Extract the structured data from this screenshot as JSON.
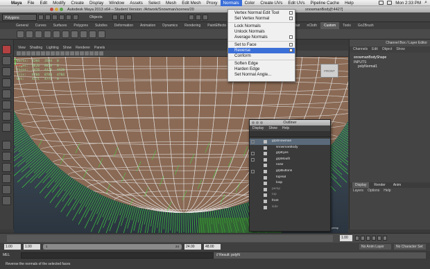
{
  "mac_menubar": {
    "app": "Maya",
    "items": [
      "File",
      "Edit",
      "Modify",
      "Create",
      "Display",
      "Window",
      "Assets",
      "Select",
      "Mesh",
      "Edit Mesh",
      "Proxy",
      "Normals",
      "Color",
      "Create UVs",
      "Edit UVs",
      "Pipeline Cache",
      "Help"
    ],
    "active_index": 11,
    "clock": "Mon 2:33 PM"
  },
  "titlebar": {
    "title": "Autodesk Maya 2013 x64 – Student Version: /Artwork/Snowman/scenes/20",
    "title_right": "snowmanBody[f:4427]"
  },
  "statusline": {
    "mode": "Polygons",
    "objects_label": "Objects"
  },
  "shelf": {
    "tabs": [
      "General",
      "Curves",
      "Surfaces",
      "Polygons",
      "Subdivs",
      "Deformation",
      "Animation",
      "Dynamics",
      "Rendering",
      "PaintEffects",
      "Toon",
      "Muscle",
      "Fluids",
      "Fur",
      "Hair",
      "nCloth",
      "Custom",
      "Tools",
      "GoZBrush"
    ],
    "active_index": 16
  },
  "viewport": {
    "menu": [
      "View",
      "Shading",
      "Lighting",
      "Show",
      "Renderer",
      "Panels"
    ],
    "hud": [
      {
        "label": "Verts:",
        "a": "4204",
        "b": "3584",
        "c": "0"
      },
      {
        "label": "Edges:",
        "a": "8820",
        "b": "8820",
        "c": "0"
      },
      {
        "label": "Faces:",
        "a": "4428",
        "b": "4428",
        "c": "4428"
      },
      {
        "label": "Tris:",
        "a": "8784",
        "b": "8784",
        "c": "4784"
      },
      {
        "label": "UVs:",
        "a": "4771",
        "b": "4771",
        "c": "0"
      }
    ],
    "viewcube_label": "FRONT",
    "camera_label": "persp"
  },
  "normals_menu": {
    "items": [
      {
        "label": "Vertex Normal Edit Tool",
        "option": true
      },
      {
        "label": "Set Vertex Normal",
        "option": true
      },
      {
        "sep": true
      },
      {
        "label": "Lock Normals",
        "option": false
      },
      {
        "label": "Unlock Normals",
        "option": false
      },
      {
        "label": "Average Normals",
        "option": true
      },
      {
        "sep": true
      },
      {
        "label": "Set to Face",
        "option": true
      },
      {
        "label": "Reverse",
        "option": true,
        "highlight": true
      },
      {
        "label": "Conform",
        "option": false
      },
      {
        "sep": true
      },
      {
        "label": "Soften Edge",
        "option": false
      },
      {
        "label": "Harden Edge",
        "option": false
      },
      {
        "label": "Set Normal Angle...",
        "option": false
      }
    ]
  },
  "channel_box": {
    "title": "Channel Box / Layer Editor",
    "menu": [
      "Channels",
      "Edit",
      "Object",
      "Show"
    ],
    "node": "snowmanBodyShape",
    "inputs_label": "INPUTS",
    "input_node": "polyNormal1",
    "layer_tabs": [
      "Display",
      "Render",
      "Anim"
    ],
    "layer_active": 0,
    "layer_menu": [
      "Layers",
      "Options",
      "Help"
    ]
  },
  "outliner": {
    "title": "Outliner",
    "menu": [
      "Display",
      "Show",
      "Help"
    ],
    "rows": [
      {
        "label": "grpSnowman",
        "expand": true,
        "selected": true,
        "dim": false,
        "indent": 0
      },
      {
        "label": "snowmanBody",
        "expand": false,
        "selected": false,
        "dim": false,
        "indent": 1
      },
      {
        "label": "grpEyes",
        "expand": true,
        "selected": false,
        "dim": false,
        "indent": 1
      },
      {
        "label": "grpMouth",
        "expand": true,
        "selected": false,
        "dim": false,
        "indent": 1
      },
      {
        "label": "nose",
        "expand": false,
        "selected": false,
        "dim": false,
        "indent": 1
      },
      {
        "label": "grpButtons",
        "expand": true,
        "selected": false,
        "dim": false,
        "indent": 1
      },
      {
        "label": "topHat",
        "expand": false,
        "selected": false,
        "dim": false,
        "indent": 1
      },
      {
        "label": "loop",
        "expand": false,
        "selected": false,
        "dim": false,
        "indent": 1
      },
      {
        "label": "persp",
        "expand": false,
        "selected": false,
        "dim": true,
        "indent": 0
      },
      {
        "label": "top",
        "expand": false,
        "selected": false,
        "dim": true,
        "indent": 0
      },
      {
        "label": "front",
        "expand": false,
        "selected": false,
        "dim": false,
        "indent": 0
      },
      {
        "label": "side",
        "expand": false,
        "selected": false,
        "dim": true,
        "indent": 0
      }
    ]
  },
  "timeline": {
    "current_frame": "1.00"
  },
  "range": {
    "start": "1.00",
    "inner_start": "1.00",
    "slider_start": "1",
    "slider_end": "24",
    "inner_end": "24.00",
    "end": "48.00",
    "anim_layer": "No Anim Layer",
    "char_set": "No Character Set"
  },
  "cmdline": {
    "label": "MEL",
    "result": "// Result: polyN"
  },
  "helpline": {
    "text": "Reverse the normals of the selected faces"
  },
  "colors": {
    "accent": "#3b6fd8",
    "wire": "#e8e8e8",
    "normals": "#3ee03e",
    "surface": "#8a6a55"
  }
}
